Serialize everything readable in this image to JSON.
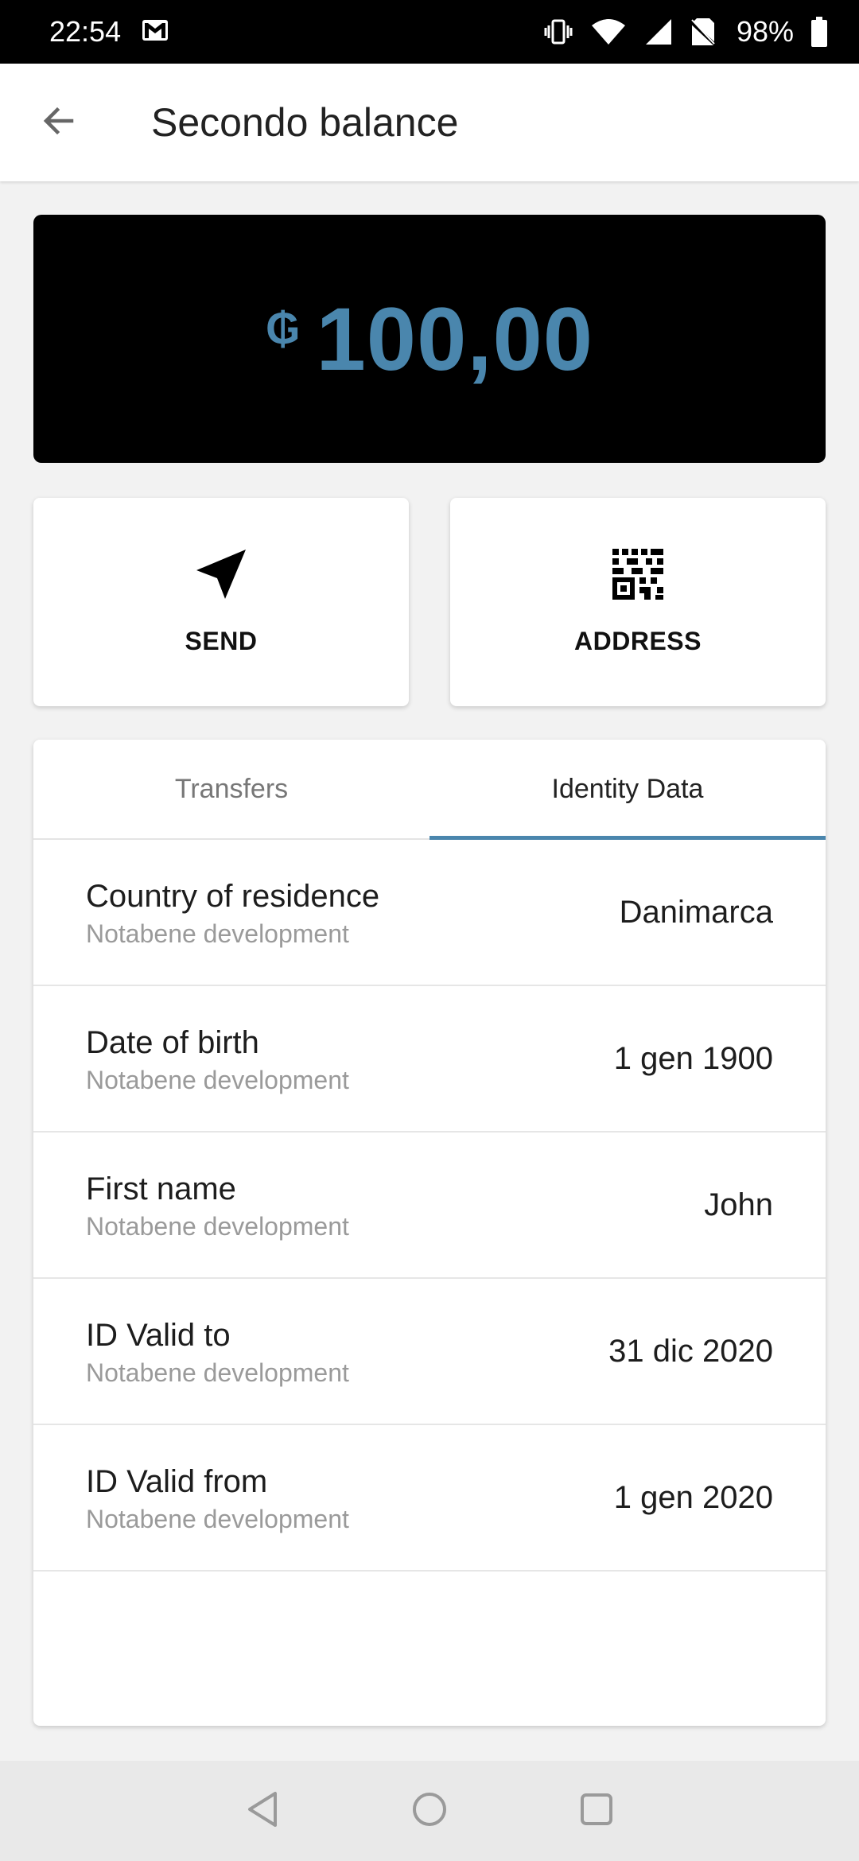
{
  "status_bar": {
    "time": "22:54",
    "battery": "98%",
    "icons": [
      "gmail-icon",
      "vibrate-icon",
      "wifi-icon",
      "signal-icon",
      "no-sim-icon",
      "battery-icon"
    ]
  },
  "app_bar": {
    "title": "Secondo balance",
    "back_icon": "arrow-back-icon"
  },
  "balance": {
    "currency_symbol": "₲",
    "amount": "100,00",
    "accent_color": "#4a86ad"
  },
  "actions": {
    "send_label": "SEND",
    "address_label": "ADDRESS"
  },
  "tabs": [
    {
      "label": "Transfers",
      "active": false
    },
    {
      "label": "Identity Data",
      "active": true
    }
  ],
  "identity_rows": [
    {
      "label": "Country of residence",
      "source": "Notabene development",
      "value": "Danimarca"
    },
    {
      "label": "Date of birth",
      "source": "Notabene development",
      "value": "1 gen 1900"
    },
    {
      "label": "First name",
      "source": "Notabene development",
      "value": "John"
    },
    {
      "label": "ID Valid to",
      "source": "Notabene development",
      "value": "31 dic 2020"
    },
    {
      "label": "ID Valid from",
      "source": "Notabene development",
      "value": "1 gen 2020"
    }
  ]
}
